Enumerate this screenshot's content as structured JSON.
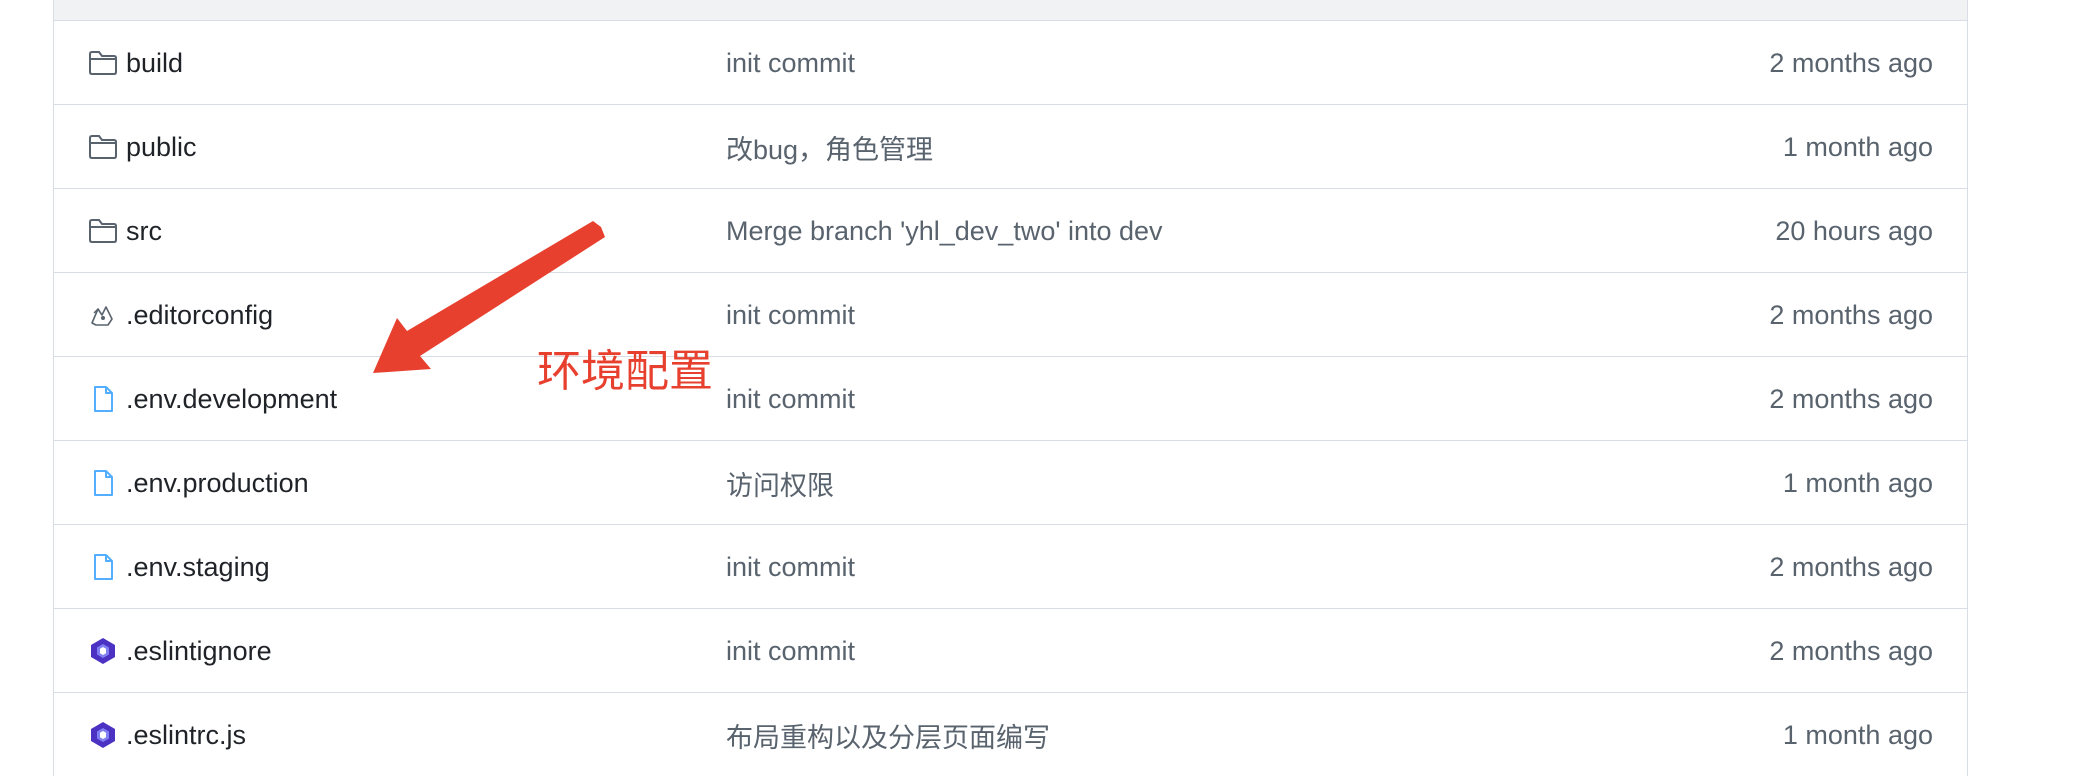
{
  "rows": [
    {
      "name": "build",
      "icon": "folder-icon",
      "commit": "init commit",
      "time": "2 months ago"
    },
    {
      "name": "public",
      "icon": "folder-icon",
      "commit": "改bug，角色管理",
      "time": "1 month ago"
    },
    {
      "name": "src",
      "icon": "folder-icon",
      "commit": "Merge branch 'yhl_dev_two' into dev",
      "time": "20 hours ago"
    },
    {
      "name": ".editorconfig",
      "icon": "editorconfig-icon",
      "commit": "init commit",
      "time": "2 months ago"
    },
    {
      "name": ".env.development",
      "icon": "file-icon",
      "commit": "init commit",
      "time": "2 months ago"
    },
    {
      "name": ".env.production",
      "icon": "file-icon",
      "commit": "访问权限",
      "time": "1 month ago"
    },
    {
      "name": ".env.staging",
      "icon": "file-icon",
      "commit": "init commit",
      "time": "2 months ago"
    },
    {
      "name": ".eslintignore",
      "icon": "eslint-icon",
      "commit": "init commit",
      "time": "2 months ago"
    },
    {
      "name": ".eslintrc.js",
      "icon": "eslint-icon",
      "commit": "布局重构以及分层页面编写",
      "time": "1 month ago"
    }
  ],
  "annotation": {
    "label": "环境配置",
    "color": "#e8402e"
  },
  "colors": {
    "text": "#1f2328",
    "muted": "#59636e",
    "border": "#d8dee4",
    "header_bg": "#f1f2f4",
    "file_icon": "#54aeff",
    "eslint_icon": "#4b32c3"
  }
}
